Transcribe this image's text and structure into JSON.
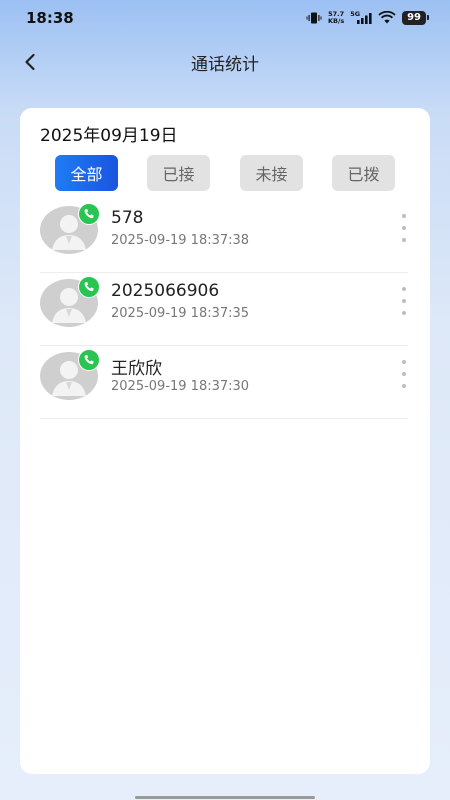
{
  "status_bar": {
    "time": "18:38",
    "net_speed_value": "57.7",
    "net_speed_unit": "KB/s",
    "network": "5G",
    "battery": "99"
  },
  "header": {
    "title": "通话统计",
    "back_icon": "chevron-left-icon"
  },
  "card": {
    "date": "2025年09月19日",
    "tabs": [
      {
        "label": "全部",
        "active": true
      },
      {
        "label": "已接",
        "active": false
      },
      {
        "label": "未接",
        "active": false
      },
      {
        "label": "已拨",
        "active": false
      }
    ],
    "calls": [
      {
        "name": "578",
        "time": "2025-09-19 18:37:38"
      },
      {
        "name": "2025066906",
        "time": "2025-09-19 18:37:35"
      },
      {
        "name": "王欣欣",
        "time": "2025-09-19 18:37:30"
      }
    ]
  },
  "colors": {
    "accent": "#1a6ef0",
    "badge_green": "#29c452",
    "tab_inactive": "#e2e2e2"
  }
}
